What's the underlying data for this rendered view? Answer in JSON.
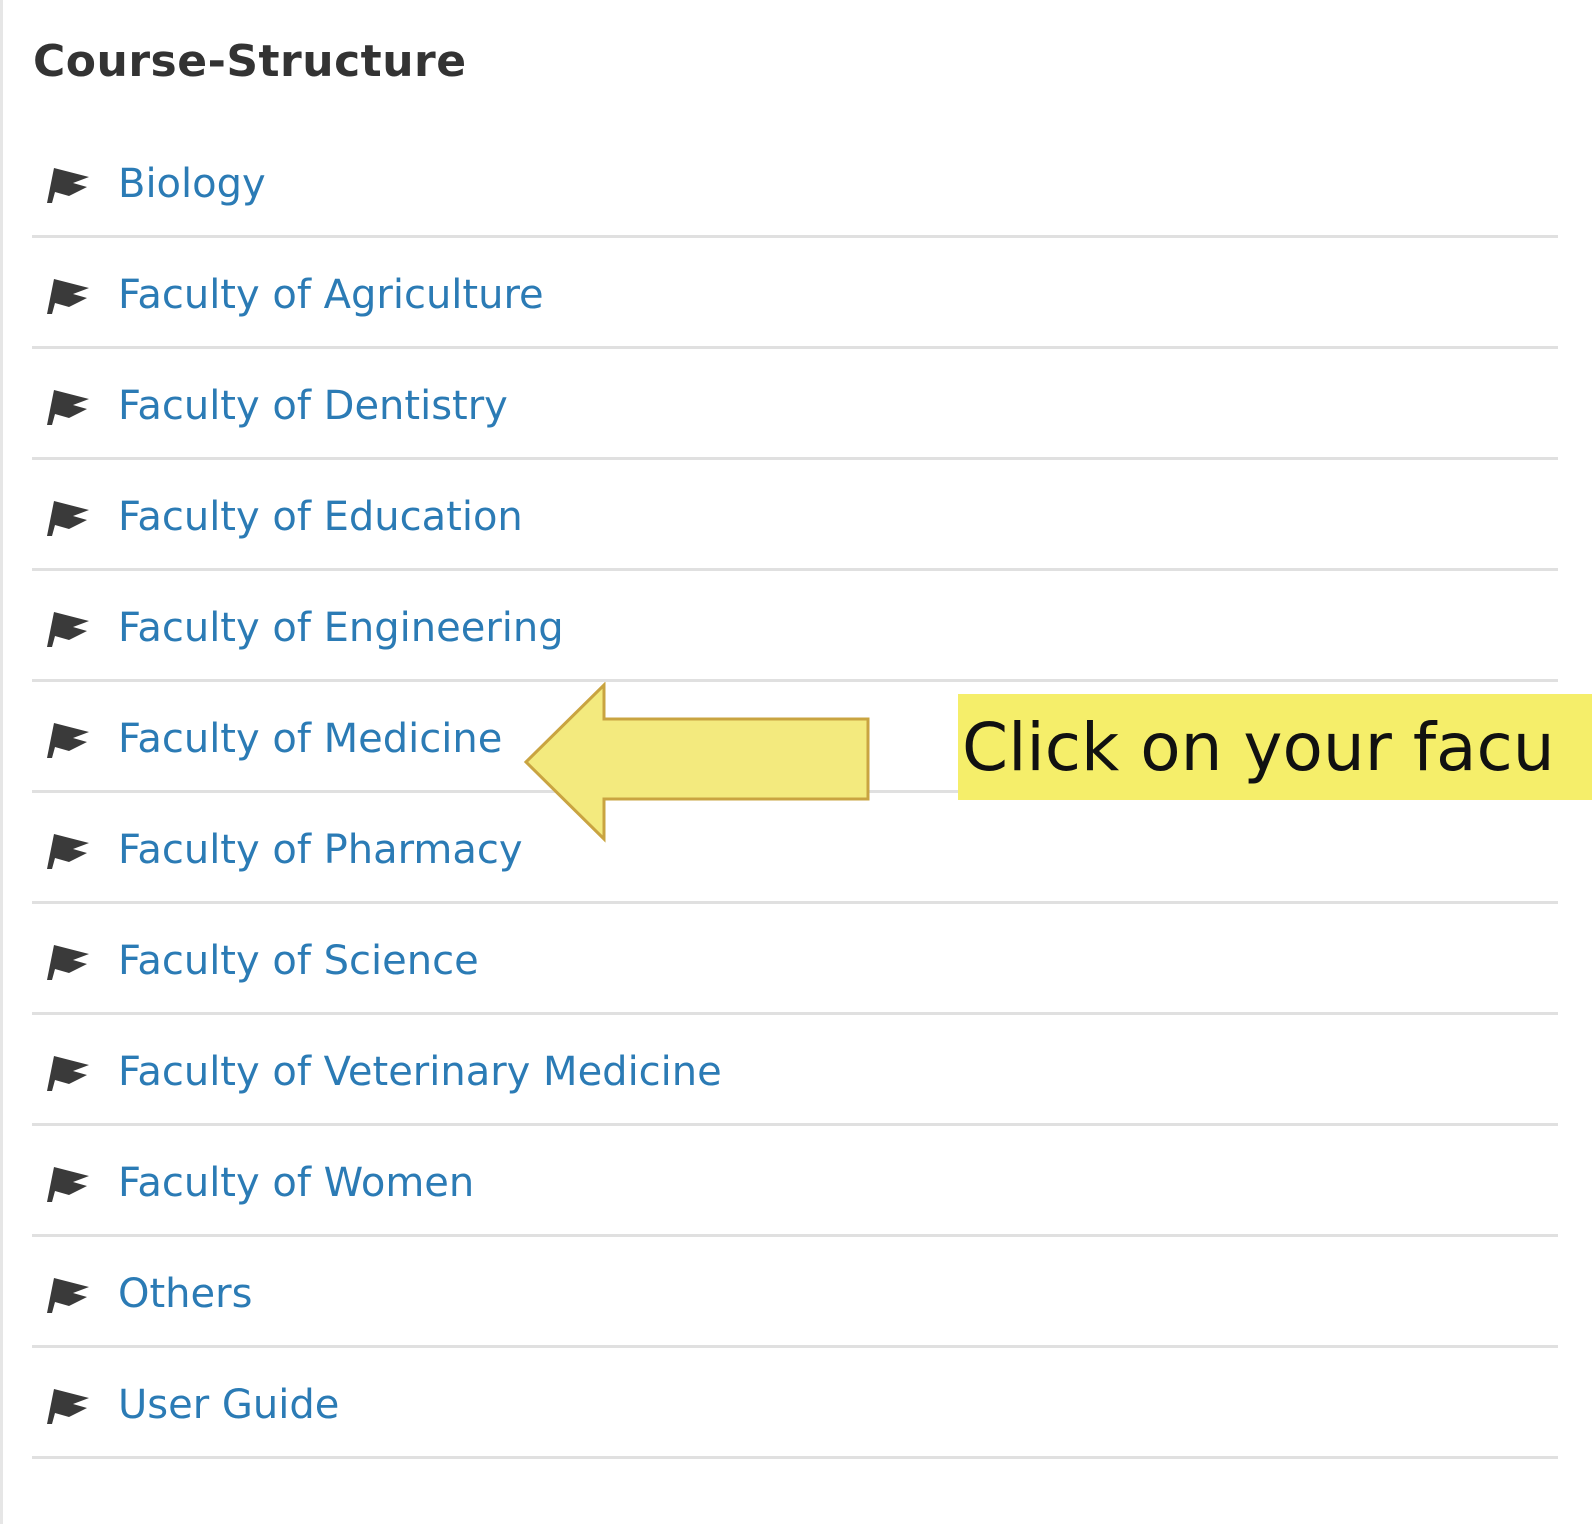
{
  "heading": "Course-Structure",
  "icon_name": "graduation-cap-icon",
  "link_color": "#2b7bb5",
  "items": [
    {
      "label": "Biology"
    },
    {
      "label": "Faculty of Agriculture"
    },
    {
      "label": "Faculty of Dentistry"
    },
    {
      "label": "Faculty of Education"
    },
    {
      "label": "Faculty of Engineering"
    },
    {
      "label": "Faculty of Medicine"
    },
    {
      "label": "Faculty of Pharmacy"
    },
    {
      "label": "Faculty of Science"
    },
    {
      "label": "Faculty of Veterinary Medicine"
    },
    {
      "label": "Faculty of Women"
    },
    {
      "label": "Others"
    },
    {
      "label": "User Guide"
    }
  ],
  "annotation": {
    "text": "Click on your facu",
    "highlight_color": "#f5ee6a",
    "arrow_color": "#f3ea7e"
  }
}
